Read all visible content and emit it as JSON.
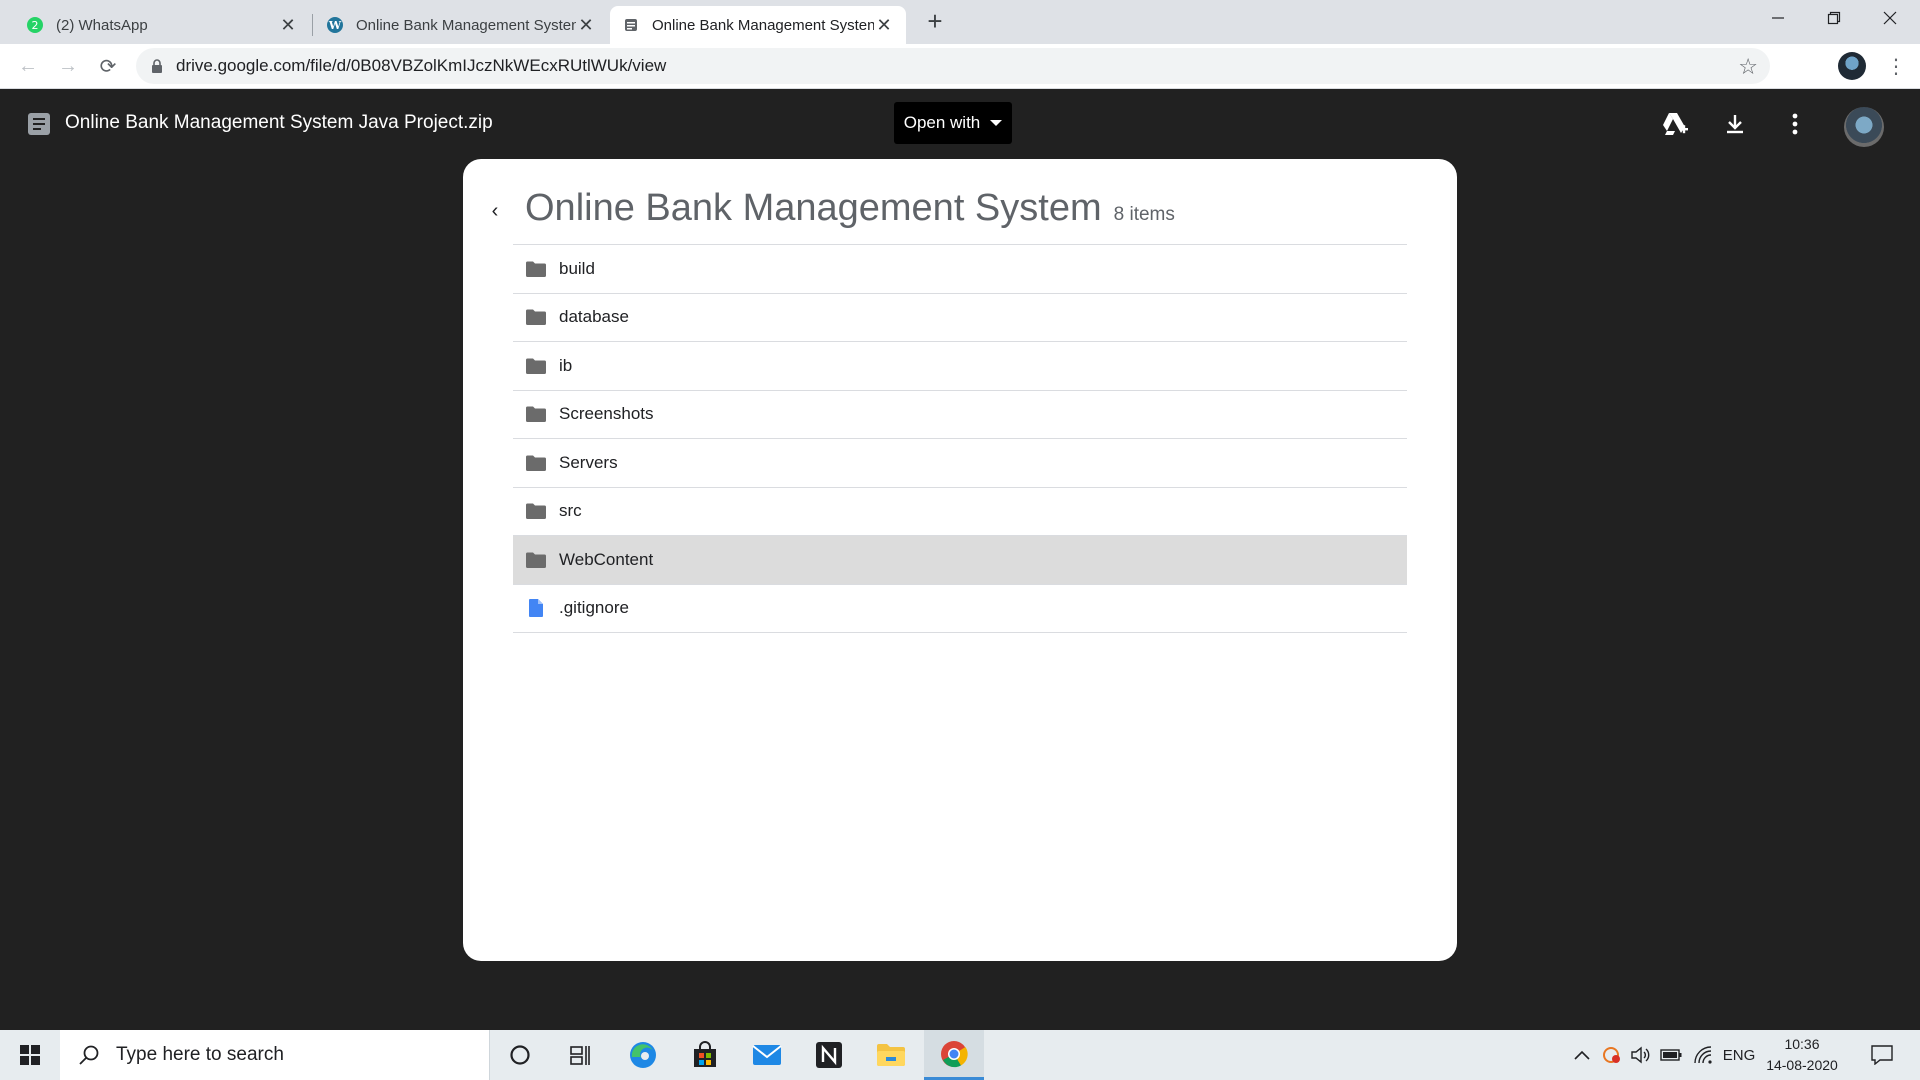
{
  "browser": {
    "tabs": [
      {
        "title": "(2) WhatsApp",
        "favicon": "whatsapp-icon"
      },
      {
        "title": "Online Bank Management Systen",
        "favicon": "wordpress-icon"
      },
      {
        "title": "Online Bank Management Systen",
        "favicon": "drive-doc-icon"
      }
    ],
    "new_tab_label": "+",
    "url": "drive.google.com/file/d/0B08VBZolKmIJczNkWEcxRUtlWUk/view"
  },
  "viewer": {
    "file_title": "Online Bank Management System Java Project.zip",
    "open_with_label": "Open with",
    "folder_name": "Online Bank Management System",
    "item_count": "8 items",
    "items": [
      {
        "name": "build",
        "type": "folder"
      },
      {
        "name": "database",
        "type": "folder"
      },
      {
        "name": "ib",
        "type": "folder"
      },
      {
        "name": "Screenshots",
        "type": "folder"
      },
      {
        "name": "Servers",
        "type": "folder"
      },
      {
        "name": "src",
        "type": "folder"
      },
      {
        "name": "WebContent",
        "type": "folder",
        "selected": true
      },
      {
        "name": ".gitignore",
        "type": "file"
      }
    ]
  },
  "taskbar": {
    "search_placeholder": "Type here to search",
    "language": "ENG",
    "time": "10:36",
    "date": "14-08-2020"
  },
  "colors": {
    "viewer_background": "#212121",
    "folder_icon": "#6b6b6b",
    "file_icon": "#4285f4",
    "selected_row": "#dcdcdc"
  }
}
